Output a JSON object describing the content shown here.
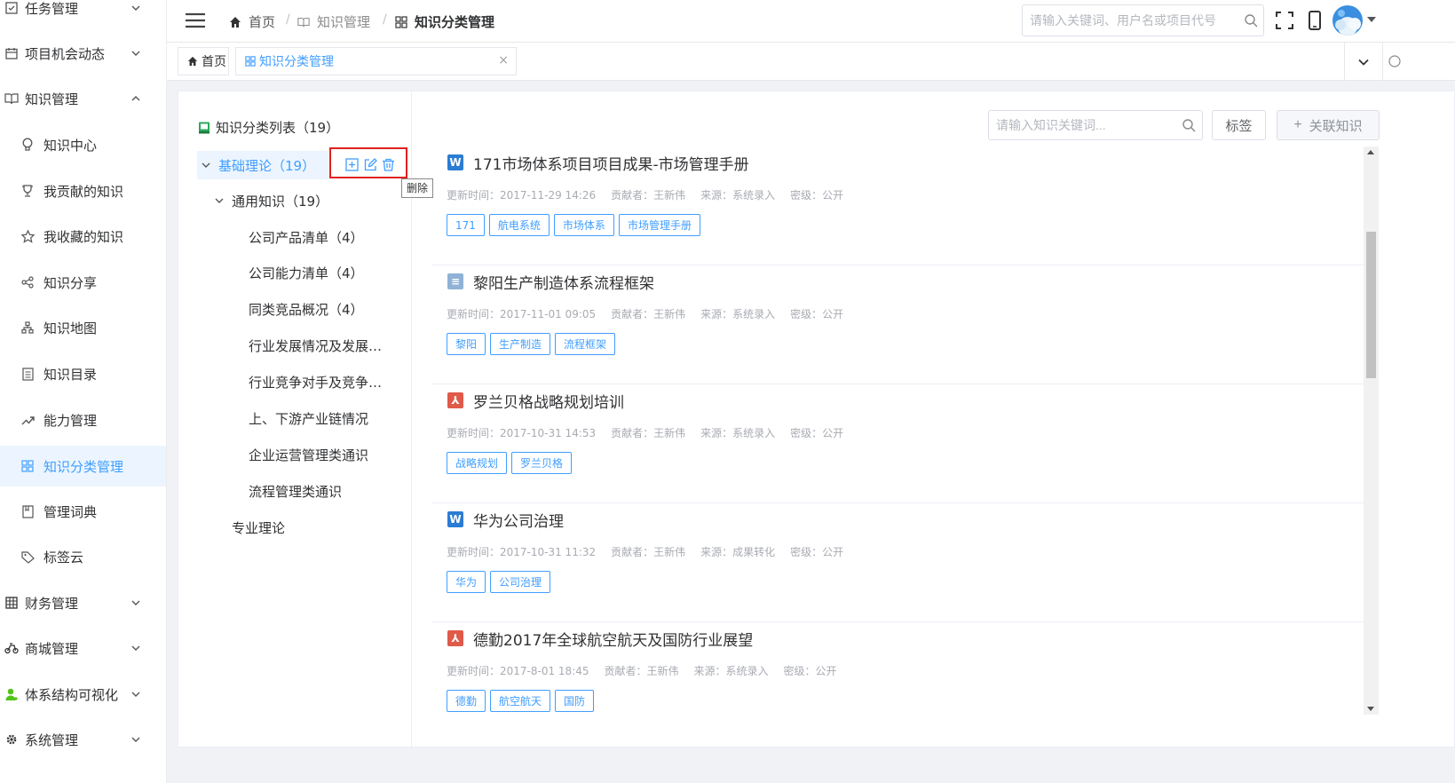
{
  "sidebar": {
    "items": [
      {
        "label": "任务管理",
        "icon": "checkbox-icon",
        "level": "top",
        "chevron": "down"
      },
      {
        "label": "项目机会动态",
        "icon": "calendar-icon",
        "level": "top",
        "chevron": "down"
      },
      {
        "label": "知识管理",
        "icon": "book-icon",
        "level": "top",
        "chevron": "up"
      },
      {
        "label": "知识中心",
        "icon": "lightbulb-icon",
        "level": "sub"
      },
      {
        "label": "我贡献的知识",
        "icon": "trophy-icon",
        "level": "sub"
      },
      {
        "label": "我收藏的知识",
        "icon": "star-icon",
        "level": "sub"
      },
      {
        "label": "知识分享",
        "icon": "share-icon",
        "level": "sub"
      },
      {
        "label": "知识地图",
        "icon": "sitemap-icon",
        "level": "sub"
      },
      {
        "label": "知识目录",
        "icon": "list-icon",
        "level": "sub"
      },
      {
        "label": "能力管理",
        "icon": "trend-icon",
        "level": "sub"
      },
      {
        "label": "知识分类管理",
        "icon": "grid-icon",
        "level": "sub",
        "active": true
      },
      {
        "label": "管理词典",
        "icon": "bookmark-icon",
        "level": "sub"
      },
      {
        "label": "标签云",
        "icon": "tag-icon",
        "level": "sub"
      },
      {
        "label": "财务管理",
        "icon": "table-icon",
        "level": "top",
        "chevron": "down"
      },
      {
        "label": "商城管理",
        "icon": "bike-icon",
        "level": "top",
        "chevron": "down"
      },
      {
        "label": "体系结构可视化",
        "icon": "user-green-icon",
        "level": "top",
        "chevron": "down"
      },
      {
        "label": "系统管理",
        "icon": "gear-icon",
        "level": "top",
        "chevron": "down"
      }
    ]
  },
  "header": {
    "breadcrumb": [
      "首页",
      "知识管理",
      "知识分类管理"
    ],
    "search_placeholder": "请输入关键词、用户名或项目代号"
  },
  "tabs": {
    "items": [
      {
        "label": "首页"
      },
      {
        "label": "知识分类管理",
        "active": true,
        "close": "×"
      }
    ]
  },
  "tree": {
    "title": "知识分类列表（19）",
    "nodes": [
      {
        "label": "基础理论（19）",
        "selected": true
      },
      {
        "label": "通用知识（19）"
      },
      {
        "label": "公司产品清单（4）"
      },
      {
        "label": "公司能力清单（4）"
      },
      {
        "label": "同类竞品概况（4）"
      },
      {
        "label": "行业发展情况及发展…"
      },
      {
        "label": "行业竞争对手及竞争…"
      },
      {
        "label": "上、下游产业链情况"
      },
      {
        "label": "企业运营管理类通识"
      },
      {
        "label": "流程管理类通识"
      },
      {
        "label": "专业理论"
      }
    ],
    "tooltip": "删除"
  },
  "toolbar": {
    "search_placeholder": "请输入知识关键词...",
    "tag_button": "标签",
    "link_button": "关联知识",
    "link_plus": "+"
  },
  "knowledge": {
    "items": [
      {
        "type": "word",
        "type_glyph": "W",
        "title": "171市场体系项目项目成果-市场管理手册",
        "updated": "更新时间：2017-11-29 14:26",
        "contributor": "贡献者：王新伟",
        "source": "来源：系统录入",
        "secret": "密级：公开",
        "tags": [
          "171",
          "航电系统",
          "市场体系",
          "市场管理手册"
        ]
      },
      {
        "type": "doc",
        "type_glyph": "≡",
        "title": "黎阳生产制造体系流程框架",
        "updated": "更新时间：2017-11-01 09:05",
        "contributor": "贡献者：王新伟",
        "source": "来源：系统录入",
        "secret": "密级：公开",
        "tags": [
          "黎阳",
          "生产制造",
          "流程框架"
        ]
      },
      {
        "type": "pdf",
        "type_glyph": "⅄",
        "title": "罗兰贝格战略规划培训",
        "updated": "更新时间：2017-10-31 14:53",
        "contributor": "贡献者：王新伟",
        "source": "来源：系统录入",
        "secret": "密级：公开",
        "tags": [
          "战略规划",
          "罗兰贝格"
        ]
      },
      {
        "type": "word",
        "type_glyph": "W",
        "title": "华为公司治理",
        "updated": "更新时间：2017-10-31 11:32",
        "contributor": "贡献者：王新伟",
        "source": "来源：成果转化",
        "secret": "密级：公开",
        "tags": [
          "华为",
          "公司治理"
        ]
      },
      {
        "type": "pdf",
        "type_glyph": "⅄",
        "title": "德勤2017年全球航空航天及国防行业展望",
        "updated": "更新时间：2017-8-01 18:45",
        "contributor": "贡献者：王新伟",
        "source": "来源：系统录入",
        "secret": "密级：公开",
        "tags": [
          "德勤",
          "航空航天",
          "国防"
        ]
      }
    ]
  },
  "colors": {
    "accent": "#409eff",
    "word": "#2b7cd3",
    "doc": "#8fb2d6",
    "pdf": "#e05a4a",
    "highlight_box": "#e02020"
  }
}
